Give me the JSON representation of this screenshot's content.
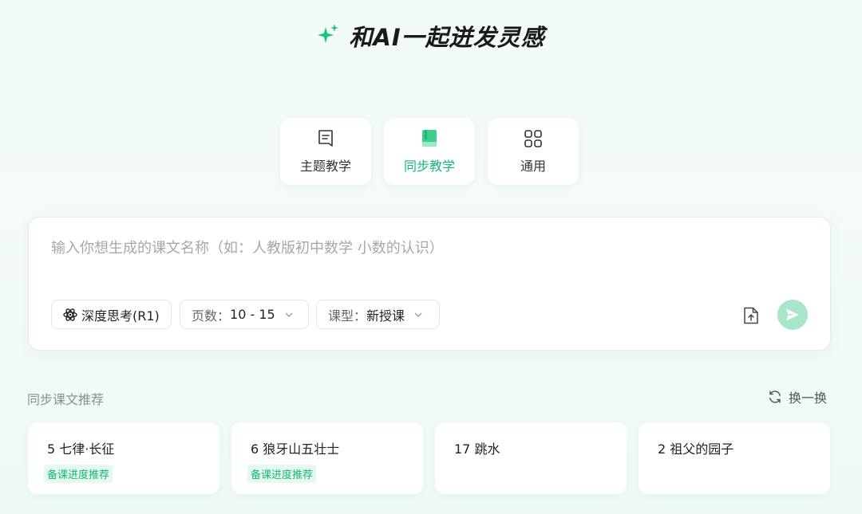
{
  "hero": {
    "title": "和AI一起迸发灵感",
    "icon": "sparkle-icon",
    "accent": "#1dc181"
  },
  "tabs": [
    {
      "label": "主题教学",
      "icon": "document-icon",
      "active": false
    },
    {
      "label": "同步教学",
      "icon": "book-icon",
      "active": true
    },
    {
      "label": "通用",
      "icon": "grid-icon",
      "active": false
    }
  ],
  "composer": {
    "placeholder": "输入你想生成的课文名称（如：人教版初中数学 小数的认识）",
    "value": "",
    "deep_think": {
      "label": "深度思考(R1)",
      "icon": "atom-icon"
    },
    "pages": {
      "label": "页数：",
      "value": "10 - 15"
    },
    "lesson_type": {
      "label": "课型：",
      "value": "新授课"
    },
    "upload_icon": "upload-file-icon",
    "send_icon": "send-icon",
    "send_color": "#a8e6ca"
  },
  "recommend": {
    "title": "同步课文推荐",
    "refresh_label": "换一换",
    "refresh_icon": "refresh-icon",
    "items": [
      {
        "title": "5 七律·长征",
        "badge": "备课进度推荐"
      },
      {
        "title": "6 狼牙山五壮士",
        "badge": "备课进度推荐"
      },
      {
        "title": "17 跳水",
        "badge": ""
      },
      {
        "title": "2 祖父的园子",
        "badge": ""
      }
    ]
  }
}
